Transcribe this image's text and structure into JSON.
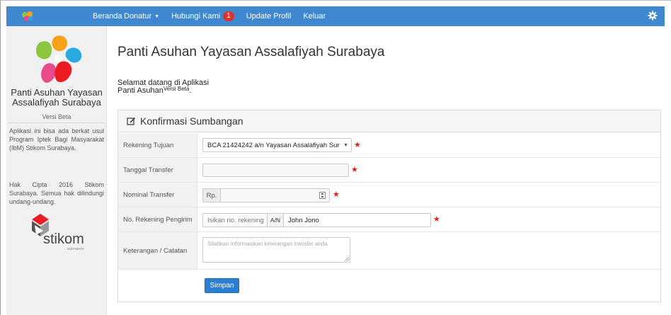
{
  "navbar": {
    "home": "Beranda",
    "donatur": "Donatur",
    "hubungi": "Hubungi Kami",
    "hubungi_badge": "1",
    "update": "Update Profil",
    "logout": "Keluar",
    "bar_color": "#3f88cf"
  },
  "sidebar": {
    "title_line1": "Panti Asuhan Yayasan",
    "title_line2": "Assalafiyah Surabaya",
    "version": "Versi Beta",
    "description": "Aplikasi ini bisa ada berkat usul Program Iptek Bagi Masyarakat (IbM) Stikom Surabaya.",
    "copyright": "Hak Cipta 2016 Stikom Surabaya. Semua hak dilindungi undang-undang.",
    "partner_logo_text": "stikom",
    "partner_logo_sub": "SURABAYA"
  },
  "main": {
    "title": "Panti Asuhan Yayasan Assalafiyah Surabaya",
    "welcome_line1": "Selamat datang di Aplikasi",
    "welcome_line2": "Panti Asuhan",
    "welcome_sup": "Versi Beta",
    "welcome_end": "."
  },
  "form": {
    "heading": "Konfirmasi Sumbangan",
    "rekening_label": "Rekening Tujuan",
    "rekening_value": "BCA 21424242 a/n Yayasan Assalafiyah Sur",
    "tanggal_label": "Tanggal Transfer",
    "tanggal_value": "",
    "nominal_label": "Nominal Transfer",
    "nominal_prefix": "Rp.",
    "nominal_value": "",
    "pengirim_label": "No. Rekening Pengirim",
    "pengirim_placeholder": "Isikan no. rekening",
    "an_label": "A/N",
    "an_value": "John Jono",
    "keterangan_label": "Keterangan / Catatan",
    "keterangan_placeholder": "Silahkan informasikan keterangan transfer anda",
    "required_mark": "★",
    "save_label": "Simpan"
  },
  "colors": {
    "accent": "#2c7fd0",
    "required": "#e0201a",
    "badge": "#d9362b"
  }
}
